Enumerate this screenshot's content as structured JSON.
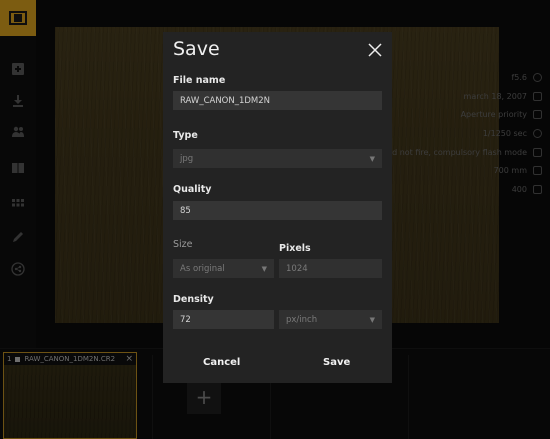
{
  "exif": [
    {
      "text": "f5.6",
      "icon": "aperture-icon"
    },
    {
      "text": "march 18, 2007",
      "icon": "calendar-icon"
    },
    {
      "text": "Aperture priority",
      "icon": "exposure-mode-icon"
    },
    {
      "text": "1/1250 sec",
      "icon": "clock-icon"
    },
    {
      "text": "did not fire, compulsory flash mode",
      "icon": "flash-icon"
    },
    {
      "text": "700 mm",
      "icon": "focal-length-icon"
    },
    {
      "text": "400",
      "icon": "iso-icon"
    }
  ],
  "filmstrip": {
    "thumb_index": "1",
    "thumb_name": "RAW_CANON_1DM2N.CR2",
    "add_label": "+"
  },
  "dialog": {
    "title": "Save",
    "file_name_label": "File name",
    "file_name_value": "RAW_CANON_1DM2N",
    "type_label": "Type",
    "type_value": "jpg",
    "quality_label": "Quality",
    "quality_value": "85",
    "size_label": "Size",
    "size_value": "As original",
    "pixels_label": "Pixels",
    "pixels_value": "1024",
    "density_label": "Density",
    "density_value": "72",
    "density_unit": "px/inch",
    "cancel_label": "Cancel",
    "save_label": "Save"
  },
  "colors": {
    "accent": "#e2a81f",
    "dialog_bg": "#232323",
    "field_bg": "#353535"
  }
}
